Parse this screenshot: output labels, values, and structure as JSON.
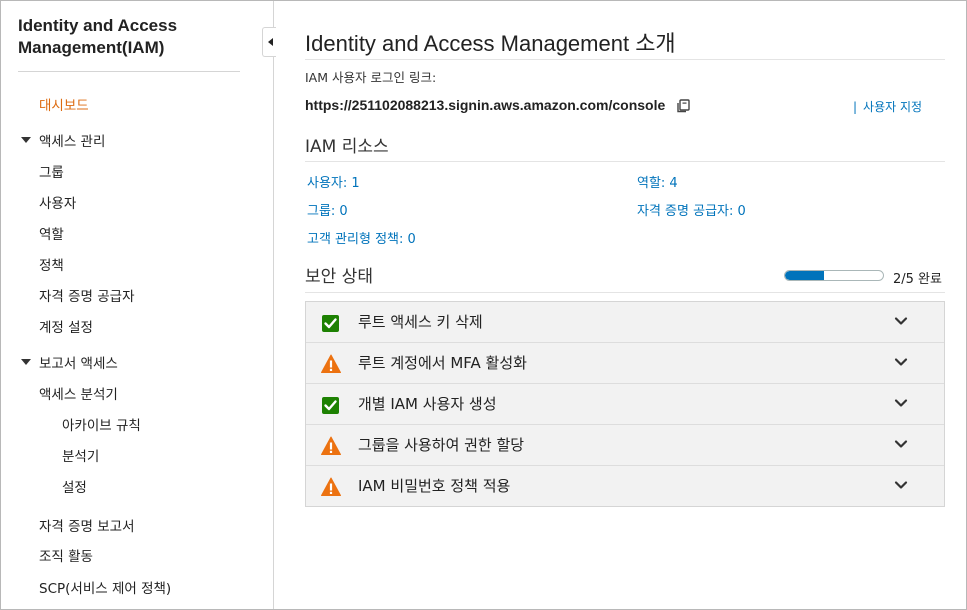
{
  "sidebar": {
    "title": "Identity and Access Management(IAM)",
    "dashboard": "대시보드",
    "access_management": {
      "label": "액세스 관리",
      "items": [
        "그룹",
        "사용자",
        "역할",
        "정책",
        "자격 증명 공급자",
        "계정 설정"
      ]
    },
    "reports": {
      "label": "보고서 액세스",
      "analyzer": "액세스 분석기",
      "sub_items": [
        "아카이브 규칙",
        "분석기",
        "설정"
      ],
      "items": [
        "자격 증명 보고서",
        "조직 활동",
        "SCP(서비스 제어 정책)"
      ]
    }
  },
  "main": {
    "title": "Identity and Access Management 소개",
    "signin_label": "IAM 사용자 로그인 링크:",
    "signin_url": "https://251102088213.signin.aws.amazon.com/console",
    "customize_bar": "|",
    "customize_label": "사용자 지정",
    "resources": {
      "heading": "IAM 리소스",
      "users": "사용자: 1",
      "roles": "역할: 4",
      "groups": "그룹: 0",
      "identity_providers": "자격 증명 공급자: 0",
      "customer_policies": "고객 관리형 정책: 0"
    },
    "security": {
      "heading": "보안 상태",
      "progress_text": "2/5 완료",
      "progress_fraction": 0.4,
      "items": [
        {
          "label": "루트 액세스 키 삭제",
          "status": "check-icon"
        },
        {
          "label": "루트 계정에서 MFA 활성화",
          "status": "warning-icon"
        },
        {
          "label": "개별 IAM 사용자 생성",
          "status": "check-icon"
        },
        {
          "label": "그룹을 사용하여 권한 할당",
          "status": "warning-icon"
        },
        {
          "label": "IAM 비밀번호 정책 적용",
          "status": "warning-icon"
        }
      ]
    }
  },
  "colors": {
    "accent_orange": "#dd6b10",
    "link_blue": "#0073bb",
    "success_green": "#1d8102",
    "warning_orange": "#ec7211"
  }
}
